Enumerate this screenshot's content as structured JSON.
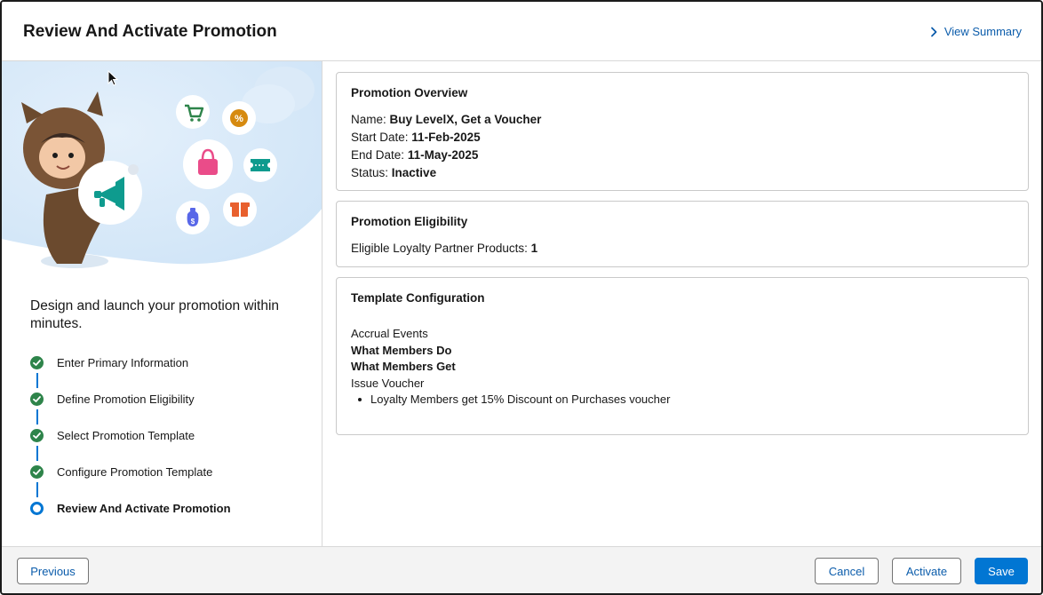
{
  "header": {
    "title": "Review And Activate Promotion",
    "view_summary_label": "View Summary"
  },
  "left_panel": {
    "tagline": "Design and launch your promotion within minutes.",
    "steps": [
      {
        "label": "Enter Primary Information",
        "status": "complete"
      },
      {
        "label": "Define Promotion Eligibility",
        "status": "complete"
      },
      {
        "label": "Select Promotion Template",
        "status": "complete"
      },
      {
        "label": "Configure Promotion Template",
        "status": "complete"
      },
      {
        "label": "Review And Activate Promotion",
        "status": "current"
      }
    ]
  },
  "overview": {
    "title": "Promotion Overview",
    "name_label": "Name:",
    "name_value": "Buy LevelX, Get a Voucher",
    "start_label": "Start Date:",
    "start_value": "11-Feb-2025",
    "end_label": "End Date:",
    "end_value": "11-May-2025",
    "status_label": "Status:",
    "status_value": "Inactive"
  },
  "eligibility": {
    "title": "Promotion Eligibility",
    "products_label": "Eligible Loyalty Partner Products:",
    "products_value": "1"
  },
  "template": {
    "title": "Template Configuration",
    "accrual": "Accrual Events",
    "members_do": "What Members Do",
    "members_get": "What Members Get",
    "issue_voucher": "Issue Voucher",
    "bullet": "Loyalty Members get 15% Discount on Purchases voucher"
  },
  "footer": {
    "previous": "Previous",
    "cancel": "Cancel",
    "activate": "Activate",
    "save": "Save"
  },
  "colors": {
    "brand": "#0176d3",
    "link": "#0b5cab",
    "success": "#2e844a"
  },
  "icons": [
    "chevron-right-icon",
    "cart-icon",
    "percent-badge-icon",
    "shopping-bag-icon",
    "ticket-icon",
    "money-bag-icon",
    "gift-icon",
    "megaphone-icon",
    "check-icon",
    "cursor-icon"
  ]
}
